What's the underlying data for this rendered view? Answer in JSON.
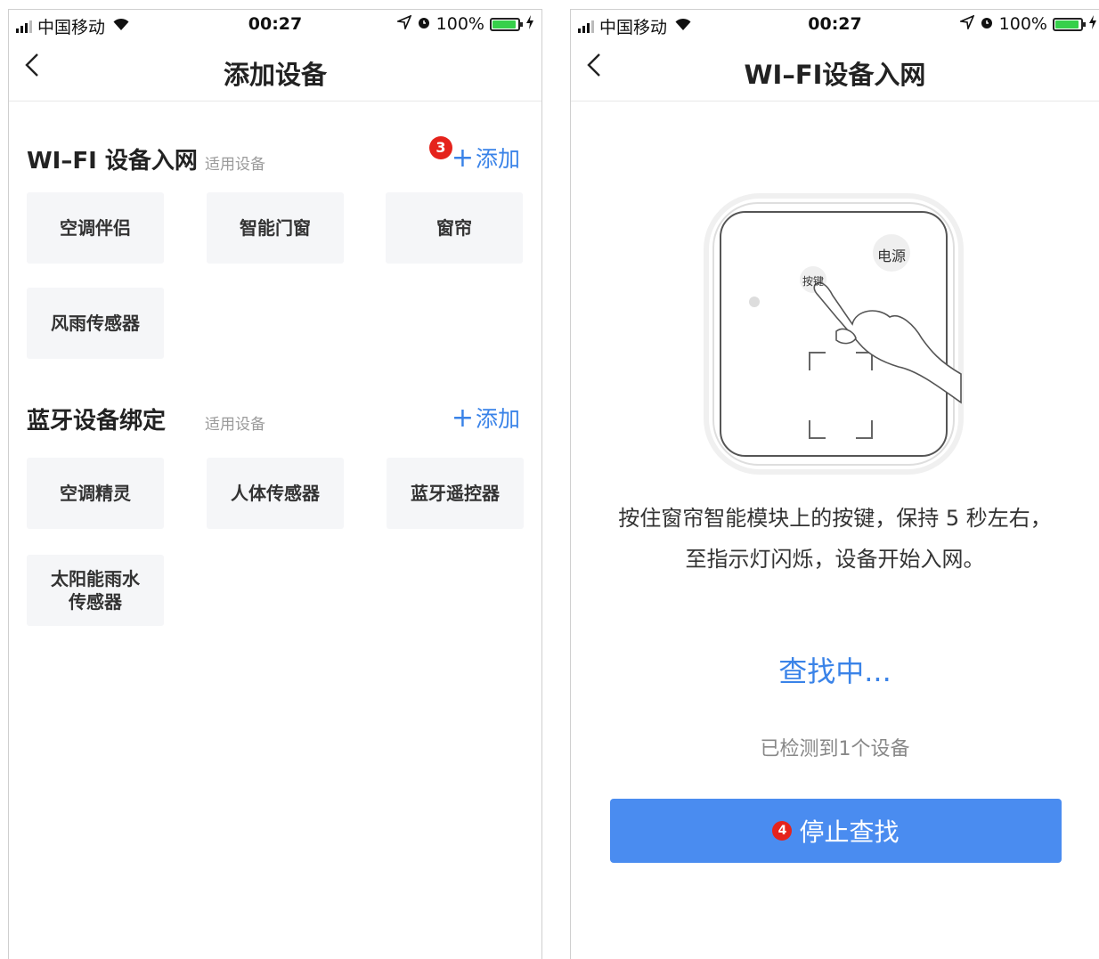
{
  "left": {
    "status": {
      "carrier": "中国移动",
      "time": "00:27",
      "battery": "100%",
      "battery_level": 1.0
    },
    "nav": {
      "title": "添加设备"
    },
    "wifi_section": {
      "title": "WI–FI 设备入网",
      "subtitle": "适用设备",
      "add_label": "添加",
      "badge": "3",
      "devices": [
        "空调伴侣",
        "智能门窗",
        "窗帘",
        "风雨传感器"
      ]
    },
    "bt_section": {
      "title": "蓝牙设备绑定",
      "subtitle": "适用设备",
      "add_label": "添加",
      "devices": [
        "空调精灵",
        "人体传感器",
        "蓝牙遥控器",
        "太阳能雨水\n传感器"
      ]
    }
  },
  "right": {
    "status": {
      "carrier": "中国移动",
      "time": "00:27",
      "battery": "100%",
      "battery_level": 1.0
    },
    "nav": {
      "title": "WI–FI设备入网"
    },
    "illustration": {
      "power_label": "电源",
      "button_label": "按键"
    },
    "instruction_line1": "按住窗帘智能模块上的按键，保持 5 秒左右，",
    "instruction_line2": "至指示灯闪烁，设备开始入网。",
    "searching": "查找中...",
    "detected": "已检测到1个设备",
    "stop_button": {
      "label": "停止查找",
      "badge": "4"
    }
  },
  "colors": {
    "accent": "#3a83e8",
    "button": "#4a8cf0",
    "badge": "#e5231c",
    "tile": "#f5f6f8"
  }
}
